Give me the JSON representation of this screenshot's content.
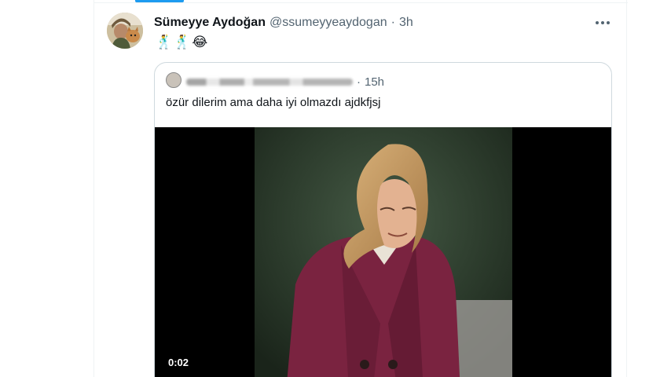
{
  "tweet": {
    "display_name": "Sümeyye Aydoğan",
    "handle": "@ssumeyyeaydogan",
    "separator": "·",
    "time": "3h",
    "text": "🕺🕺😂",
    "more_icon": "more-horizontal-icon"
  },
  "quoted_tweet": {
    "separator": "·",
    "time": "15h",
    "text": "özür dilerim ama daha iyi olmazdı ajdkfjsj",
    "media": {
      "type": "video",
      "duration": "0:02"
    }
  },
  "colors": {
    "accent": "#1d9bf0",
    "secondary_text": "#536471",
    "primary_text": "#0f1419",
    "border": "#cfd9de"
  }
}
